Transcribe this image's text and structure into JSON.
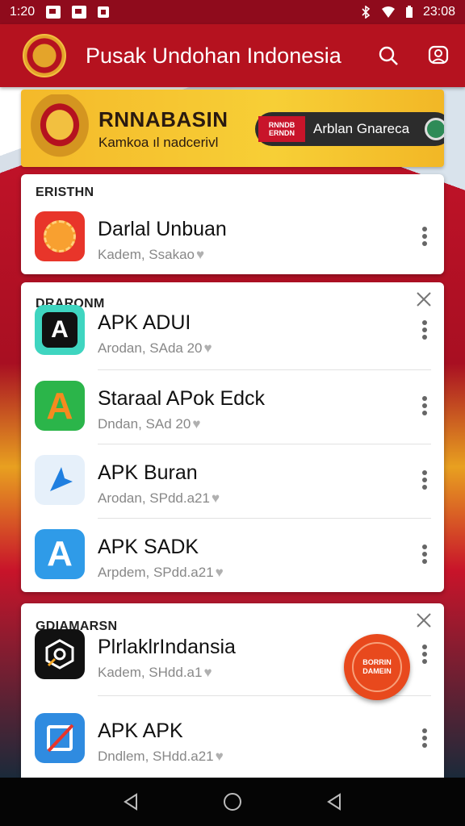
{
  "status_bar": {
    "time": "1:20",
    "clock": "23:08"
  },
  "app_bar": {
    "title": "Pusak Undohan Indonesia",
    "search_icon": "search-icon",
    "profile_icon": "profile-icon"
  },
  "banner": {
    "headline": "RNNABASIN",
    "subline": "Kamkoa ıl nadcerivl",
    "cta_tag": "RNNDB ERNDN",
    "cta_label": "Arblan Gnareca"
  },
  "sections": [
    {
      "header": "ERISTHN",
      "items": [
        {
          "name": "Darlal Unbuan",
          "meta": "Kadem, Ssakao",
          "icon_color": "#e8352a"
        }
      ]
    },
    {
      "header": "DRARONM",
      "items": [
        {
          "name": "APK ADUI",
          "meta": "Arodan, SAda 20",
          "icon_color": "#3fd5c0"
        },
        {
          "name": "Staraal APok Edck",
          "meta": "Dndan, SAd 20",
          "icon_color": "#2bb54a"
        },
        {
          "name": "APK Buran",
          "meta": "Arodan, SPdd.a21",
          "icon_color": "#e6f0fa"
        },
        {
          "name": "APK SADK",
          "meta": "Arpdem, SPdd.a21",
          "icon_color": "#2f9be8"
        }
      ]
    },
    {
      "header": "GDIAMARSN",
      "items": [
        {
          "name": "PlrlaklrIndansia",
          "meta": "Kadem, SHdd.a1",
          "icon_color": "#111111"
        },
        {
          "name": "APK APK",
          "meta": "Dndlem, SHdd.a21",
          "icon_color": "#2f8be0"
        }
      ]
    }
  ],
  "badge": {
    "text": "BORRIN DAMEIN"
  },
  "colors": {
    "primary": "#b5121f",
    "banner": "#f7cf36",
    "badge": "#e8491d"
  }
}
